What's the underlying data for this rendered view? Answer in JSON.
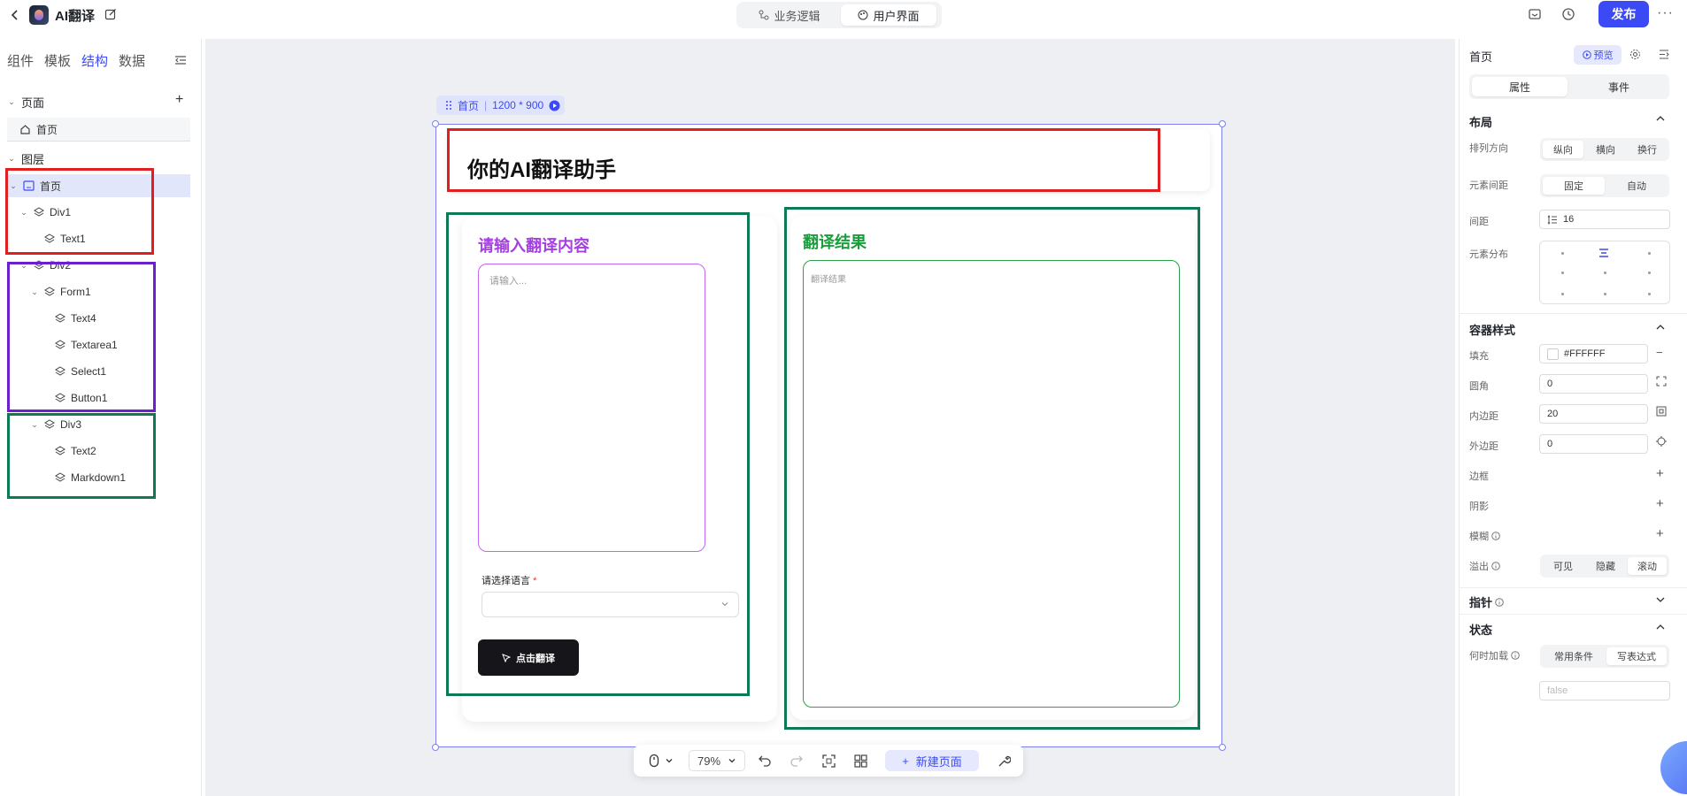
{
  "topbar": {
    "app_title": "AI翻译",
    "mode_tabs": [
      {
        "label": "业务逻辑"
      },
      {
        "label": "用户界面"
      }
    ],
    "publish_label": "发布",
    "more_label": "···"
  },
  "left_panel": {
    "tabs": [
      {
        "label": "组件"
      },
      {
        "label": "模板"
      },
      {
        "label": "结构"
      },
      {
        "label": "数据"
      }
    ],
    "pages_header": "页面",
    "page_item": "首页",
    "layers_header": "图层",
    "layers": [
      {
        "label": "首页"
      },
      {
        "label": "Div1"
      },
      {
        "label": "Text1"
      },
      {
        "label": "Div2"
      },
      {
        "label": "Form1"
      },
      {
        "label": "Text4"
      },
      {
        "label": "Textarea1"
      },
      {
        "label": "Select1"
      },
      {
        "label": "Button1"
      },
      {
        "label": "Div3"
      },
      {
        "label": "Text2"
      },
      {
        "label": "Markdown1"
      }
    ]
  },
  "canvas": {
    "frame_name": "首页",
    "frame_size": "1200 * 900",
    "header_title": "你的AI翻译助手",
    "form_title": "请输入翻译内容",
    "textarea_placeholder": "请输入...",
    "select_label": "请选择语言",
    "required_mark": "*",
    "button_label": "点击翻译",
    "result_title": "翻译结果",
    "result_placeholder": "翻译结果"
  },
  "bottom_toolbar": {
    "zoom": "79%",
    "new_page_label": "新建页面"
  },
  "right_panel": {
    "title": "首页",
    "preview_label": "预览",
    "tabs": [
      {
        "label": "属性"
      },
      {
        "label": "事件"
      }
    ],
    "layout_section": "布局",
    "direction_label": "排列方向",
    "direction_options": [
      {
        "label": "纵向"
      },
      {
        "label": "横向"
      },
      {
        "label": "换行"
      }
    ],
    "spacing_mode_label": "元素间距",
    "spacing_mode_options": [
      {
        "label": "固定"
      },
      {
        "label": "自动"
      }
    ],
    "gap_label": "间距",
    "gap_value": "16",
    "distribution_label": "元素分布",
    "container_section": "容器样式",
    "fill_label": "填充",
    "fill_value": "#FFFFFF",
    "radius_label": "圆角",
    "radius_value": "0",
    "padding_label": "内边距",
    "padding_value": "20",
    "margin_label": "外边距",
    "margin_value": "0",
    "border_label": "边框",
    "shadow_label": "阴影",
    "blur_label": "模糊",
    "overflow_label": "溢出",
    "overflow_options": [
      {
        "label": "可见"
      },
      {
        "label": "隐藏"
      },
      {
        "label": "滚动"
      }
    ],
    "pointer_section": "指针",
    "state_section": "状态",
    "load_when_label": "何时加载",
    "load_when_options": [
      {
        "label": "常用条件"
      },
      {
        "label": "写表达式"
      }
    ],
    "expression_placeholder": "false"
  },
  "colors": {
    "accent": "#3b4af5",
    "annotation_red": "#e02020",
    "annotation_purple": "#6a1fd0",
    "annotation_green": "#0e7a55",
    "form_title": "#a43fe0",
    "result_title": "#1a9e3c"
  }
}
